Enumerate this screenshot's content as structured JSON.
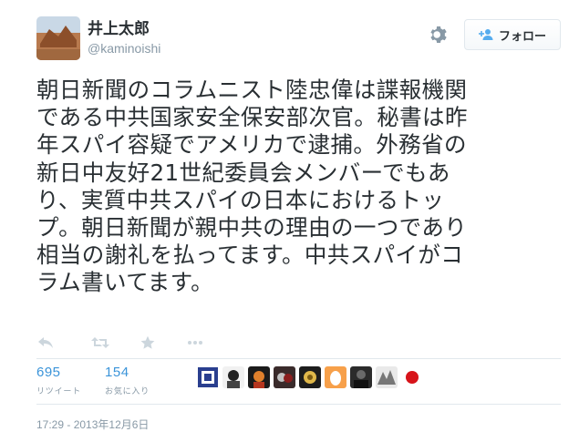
{
  "user": {
    "fullname": "井上太郎",
    "screen_name": "@kaminoishi"
  },
  "follow_button": {
    "label": "フォロー",
    "icon": "follow-user-icon"
  },
  "tweet": {
    "lines": [
      "朝日新聞のコラムニスト陸忠偉は諜報機関",
      "である中共国家安全保安部次官。秘書は昨",
      "年スパイ容疑でアメリカで逮捕。外務省の",
      "新日中友好21世紀委員会メンバーでもあ",
      "り、実質中共スパイの日本におけるトッ",
      "プ。朝日新聞が親中共の理由の一つであり",
      "相当の謝礼を払ってます。中共スパイがコ",
      "ラム書いてます。"
    ]
  },
  "actions": [
    "reply-icon",
    "retweet-icon",
    "favorite-icon",
    "more-icon"
  ],
  "stats": {
    "retweets": {
      "count": "695",
      "label": "リツイート"
    },
    "favorites": {
      "count": "154",
      "label": "お気に入り"
    }
  },
  "timestamp": "17:29 - 2013年12月6日",
  "colors": {
    "link": "#3b94d9",
    "muted": "#8899a6",
    "text": "#292f33",
    "border": "#e1e8ed"
  }
}
